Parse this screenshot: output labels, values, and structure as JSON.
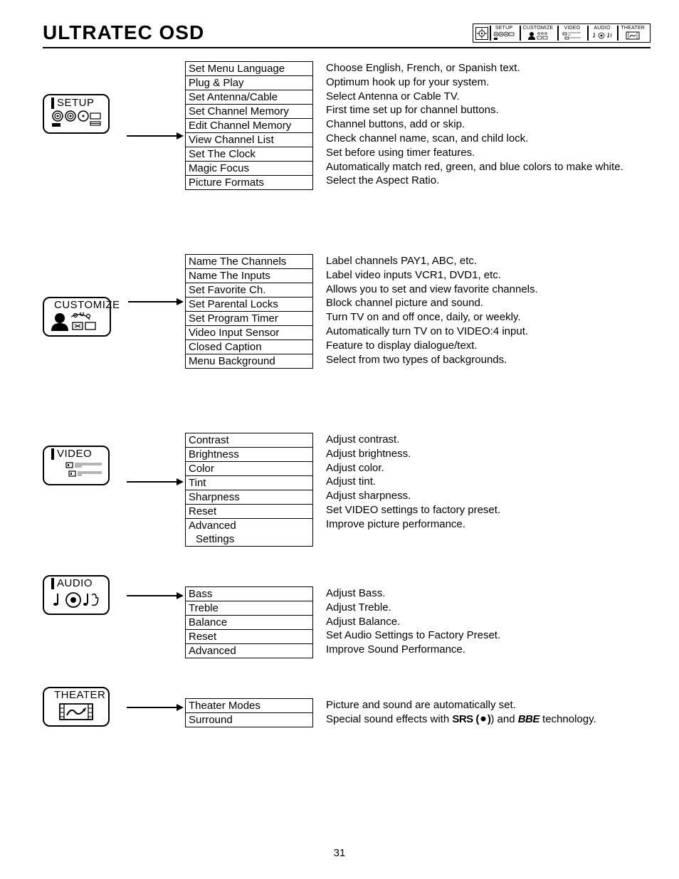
{
  "header": {
    "title": "ULTRATEC OSD"
  },
  "nav": {
    "items": [
      {
        "label": "SETUP"
      },
      {
        "label": "CUSTOMIZE"
      },
      {
        "label": "VIDEO"
      },
      {
        "label": "AUDIO"
      },
      {
        "label": "THEATER"
      }
    ]
  },
  "sections": [
    {
      "badge": "SETUP",
      "items": [
        {
          "label": "Set Menu Language",
          "desc": "Choose English, French, or Spanish text."
        },
        {
          "label": "Plug & Play",
          "desc": "Optimum hook up for your system."
        },
        {
          "label": "Set Antenna/Cable",
          "desc": "Select Antenna or Cable TV."
        },
        {
          "label": "Set Channel Memory",
          "desc": "First time set up for channel buttons."
        },
        {
          "label": "Edit Channel Memory",
          "desc": "Channel buttons, add or skip."
        },
        {
          "label": "View Channel List",
          "desc": "Check channel name, scan, and child lock."
        },
        {
          "label": "Set The Clock",
          "desc": "Set before using timer features."
        },
        {
          "label": "Magic Focus",
          "desc": "Automatically match red, green, and blue colors to make white."
        },
        {
          "label": "Picture Formats",
          "desc": "Select  the Aspect Ratio."
        }
      ]
    },
    {
      "badge": "CUSTOMIZE",
      "items": [
        {
          "label": "Name The Channels",
          "desc": "Label channels PAY1, ABC, etc."
        },
        {
          "label": "Name The Inputs",
          "desc": "Label video inputs VCR1, DVD1, etc."
        },
        {
          "label": "Set Favorite Ch.",
          "desc": "Allows you to set and view favorite channels."
        },
        {
          "label": "Set Parental Locks",
          "desc": "Block channel picture and sound."
        },
        {
          "label": "Set Program Timer",
          "desc": "Turn TV on and off once, daily, or weekly."
        },
        {
          "label": "Video Input Sensor",
          "desc": "Automatically turn TV on to VIDEO:4 input."
        },
        {
          "label": "Closed Caption",
          "desc": "Feature to display dialogue/text."
        },
        {
          "label": "Menu Background",
          "desc": "Select from two types of backgrounds."
        }
      ]
    },
    {
      "badge": "VIDEO",
      "items": [
        {
          "label": "Contrast",
          "desc": "Adjust contrast."
        },
        {
          "label": "Brightness",
          "desc": "Adjust brightness."
        },
        {
          "label": "Color",
          "desc": "Adjust color."
        },
        {
          "label": "Tint",
          "desc": "Adjust tint."
        },
        {
          "label": "Sharpness",
          "desc": "Adjust sharpness."
        },
        {
          "label": "Reset",
          "desc": "Set VIDEO settings to factory preset."
        },
        {
          "label": "Advanced",
          "desc": "Improve picture performance."
        },
        {
          "label": "  Settings",
          "desc": "",
          "indent": true,
          "noborder_above": true
        }
      ]
    },
    {
      "badge": "AUDIO",
      "items": [
        {
          "label": "Bass",
          "desc": "Adjust Bass."
        },
        {
          "label": "Treble",
          "desc": "Adjust Treble."
        },
        {
          "label": "Balance",
          "desc": "Adjust Balance."
        },
        {
          "label": "Reset",
          "desc": "Set Audio Settings to Factory Preset."
        },
        {
          "label": "Advanced",
          "desc": "Improve Sound Performance."
        }
      ]
    },
    {
      "badge": "THEATER",
      "items": [
        {
          "label": "Theater Modes",
          "desc": "Picture and sound are automatically set."
        },
        {
          "label": "Surround",
          "desc_pre": "Special sound effects with ",
          "srs": "SRS (",
          "desc_mid": ") and ",
          "brand": "BBE",
          "desc_post": " technology."
        }
      ]
    }
  ],
  "page_number": "31"
}
